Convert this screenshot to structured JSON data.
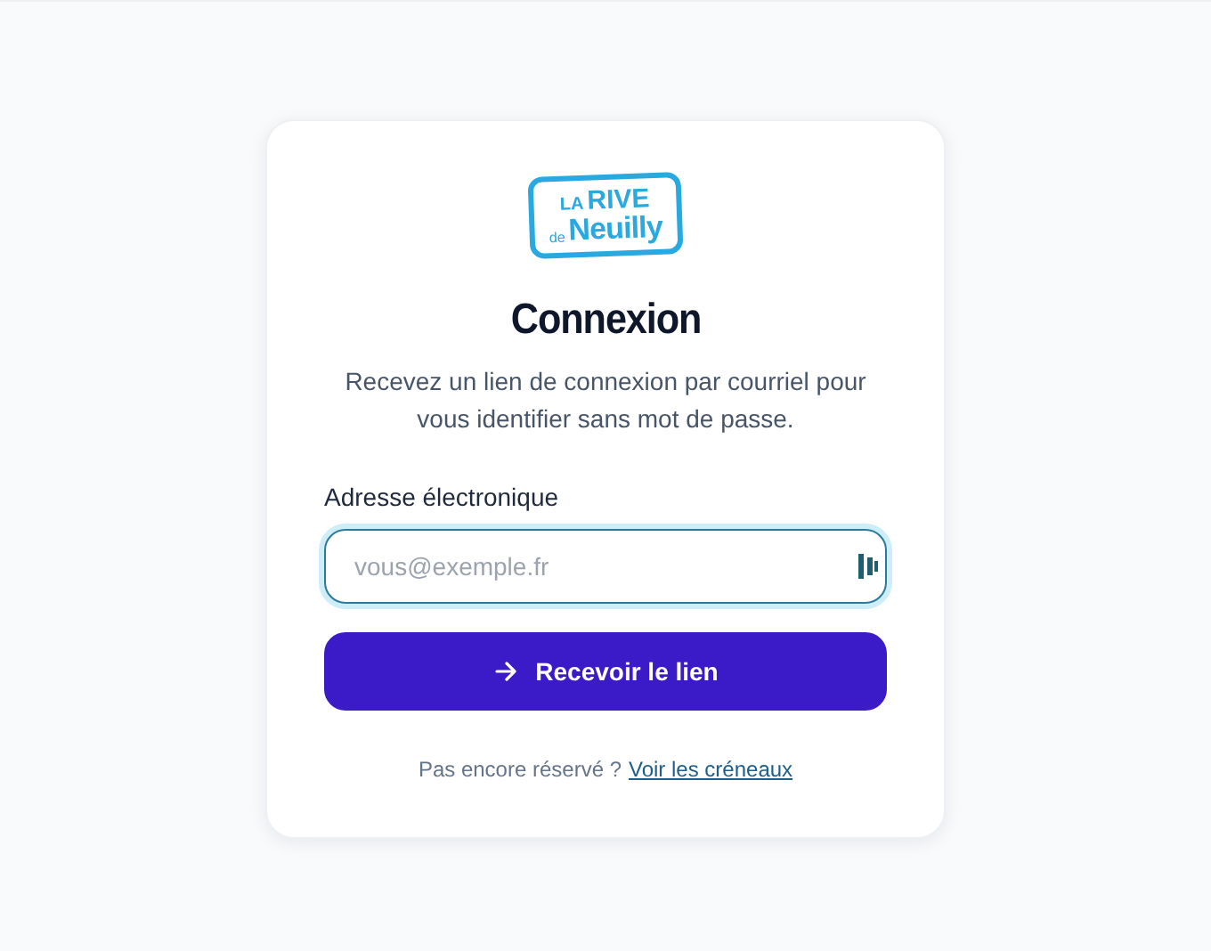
{
  "logo": {
    "line_1": [
      "LA",
      "RIVE"
    ],
    "small": "de",
    "line_2": "Neuilly"
  },
  "title": "Connexion",
  "subtitle": "Recevez un lien de connexion par courriel pour vous identifier sans mot de passe.",
  "email_field": {
    "label": "Adresse électronique",
    "placeholder": "vous@exemple.fr",
    "focused": true
  },
  "submit_button": {
    "label": "Recevoir le lien"
  },
  "footer": {
    "text": "Pas encore réservé ?",
    "link": "Voir les créneaux"
  }
}
